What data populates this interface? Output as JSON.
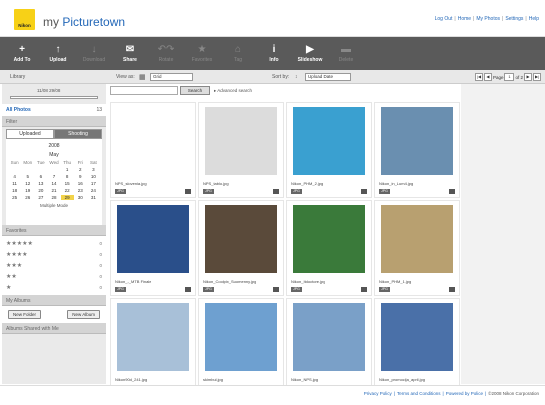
{
  "header": {
    "logo_text": "Nikon",
    "brand_prefix": "my ",
    "brand_name": "Picturetown",
    "links": [
      "Log Out",
      "Home",
      "My Photos",
      "Settings",
      "Help"
    ]
  },
  "toolbar": {
    "items": [
      {
        "label": "Add To",
        "icon": "plus-icon",
        "enabled": true
      },
      {
        "label": "Upload",
        "icon": "upload-arrow-icon",
        "enabled": true
      },
      {
        "label": "Download",
        "icon": "download-arrow-icon",
        "enabled": false
      },
      {
        "label": "Share",
        "icon": "envelope-icon",
        "enabled": true
      },
      {
        "label": "Rotate",
        "icon": "rotate-icon",
        "enabled": false
      },
      {
        "label": "Favorites",
        "icon": "star-icon",
        "enabled": false
      },
      {
        "label": "Tag",
        "icon": "tag-icon",
        "enabled": false
      },
      {
        "label": "Info",
        "icon": "info-icon",
        "enabled": true
      },
      {
        "label": "Slideshow",
        "icon": "play-icon",
        "enabled": true
      },
      {
        "label": "Delete",
        "icon": "trash-icon",
        "enabled": false
      }
    ]
  },
  "subbar": {
    "library_label": "Library",
    "view_as_label": "View as:",
    "view_value": "Grid",
    "sort_by_label": "Sort by:",
    "sort_value": "Upload Date",
    "page_label": "Page",
    "page_value": "1",
    "page_of": "of 2"
  },
  "sidebar": {
    "slider_dates": "11/08     29/08",
    "all_photos_label": "All Photos",
    "all_photos_count": "13",
    "filter_label": "Filter",
    "tab_uploaded": "Uploaded",
    "tab_shooting": "Shooting",
    "calendar": {
      "year": "2008",
      "month": "May",
      "days_header": [
        "Sun",
        "Mon",
        "Tue",
        "Wed",
        "Thu",
        "Fri",
        "Sat"
      ],
      "days": [
        "",
        "",
        "",
        "",
        "1",
        "2",
        "3",
        "4",
        "5",
        "6",
        "7",
        "8",
        "9",
        "10",
        "11",
        "12",
        "13",
        "14",
        "15",
        "16",
        "17",
        "18",
        "19",
        "20",
        "21",
        "22",
        "23",
        "24",
        "25",
        "26",
        "27",
        "28",
        "29",
        "30",
        "31"
      ],
      "selected_day": "29",
      "multiple_mode": "Multiple Mode"
    },
    "favorites_label": "Favorites",
    "favorites": [
      {
        "stars": "★★★★★",
        "count": "0"
      },
      {
        "stars": "★★★★",
        "count": "0"
      },
      {
        "stars": "★★★",
        "count": "0"
      },
      {
        "stars": "★★",
        "count": "0"
      },
      {
        "stars": "★",
        "count": "0"
      }
    ],
    "my_albums_label": "My Albums",
    "new_folder": "New Folder",
    "new_album": "New Album",
    "shared_label": "Albums Shared with Me"
  },
  "search": {
    "button": "Search",
    "advanced": "Advanced search"
  },
  "photos": [
    {
      "name": "NPS_slovenia.jpg",
      "badge": "JPG"
    },
    {
      "name": "NPS_tablo.jpg",
      "badge": "JPG"
    },
    {
      "name": "Nikon_PHM_2.jpg",
      "badge": "JPG"
    },
    {
      "name": "Nikon_in_Lum4.jpg",
      "badge": "JPG"
    },
    {
      "name": "Nikon_-_MTB Finale",
      "badge": "JPG"
    },
    {
      "name": "Nikon_Coolpix_Suomenny.jpg",
      "badge": "JPG"
    },
    {
      "name": "Nikon_Itdoctore.jpg",
      "badge": "JPG"
    },
    {
      "name": "Nikon_PHM_1.jpg",
      "badge": "JPG"
    },
    {
      "name": "Nikon90d_241.jpg",
      "badge": "JPG"
    },
    {
      "name": "skimbul.jpg",
      "badge": "JPG"
    },
    {
      "name": "Nikon_NPS.jpg",
      "badge": "JPG"
    },
    {
      "name": "Nikon_promocija_april.jpg",
      "badge": "JPG"
    }
  ],
  "photo_colors": [
    "#ffffff",
    "#dcdcdc",
    "#3aa0d0",
    "#6a8fb0",
    "#2a4f8a",
    "#5a4a3a",
    "#3a7a3a",
    "#b8a070",
    "#a8c0d8",
    "#6ea0d0",
    "#7aa0c8",
    "#4a70a8"
  ],
  "footer": {
    "links": [
      "Privacy Policy",
      "Terms and Conditions",
      "Powered by Police"
    ],
    "copyright": "©2008 Nikon Corporation"
  },
  "colors": {
    "accent": "#2468b8",
    "toolbar_bg": "#5a5a5a",
    "logo": "#f7d117"
  }
}
